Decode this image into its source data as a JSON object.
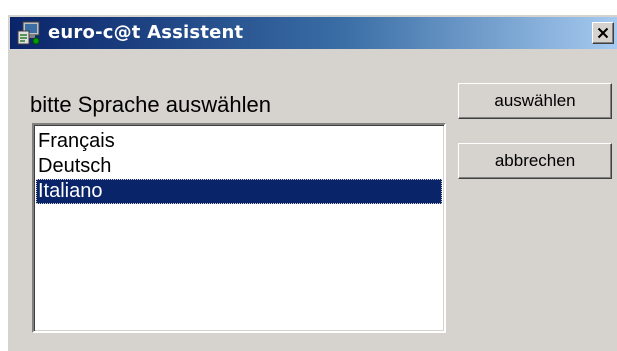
{
  "window": {
    "title": "euro-c@t Assistent",
    "icon": "wizard-app-icon",
    "close_icon": "close-icon"
  },
  "dialog": {
    "prompt": "bitte Sprache auswählen",
    "languages": [
      {
        "label": "Français",
        "selected": false
      },
      {
        "label": "Deutsch",
        "selected": false
      },
      {
        "label": "Italiano",
        "selected": true
      }
    ],
    "select_button": "auswählen",
    "cancel_button": "abbrechen"
  },
  "colors": {
    "title_start": "#0a246a",
    "title_end": "#a6caf0",
    "face": "#d6d3ce",
    "selection": "#0a246a"
  }
}
